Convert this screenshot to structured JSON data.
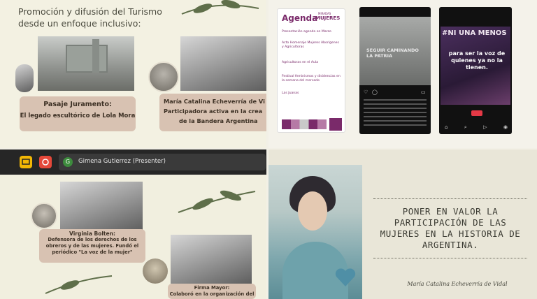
{
  "slide_tl": {
    "title": "Promoción y difusión del Turismo desde un enfoque inclusivo:",
    "cap1_line1": "Pasaje Juramento:",
    "cap1_line2": "El legado escultórico de Lola Mora",
    "cap2_line1": "María Catalina Echeverría de Vi",
    "cap2_line2": "Participadora activa en la crea",
    "cap2_line3": "de la Bandera Argentina"
  },
  "slide_tr": {
    "agenda_title": "Agenda",
    "agenda_brand_top": "MIRADAS",
    "agenda_brand": "MUJERES",
    "agenda_items": [
      "Presentación agenda en Marzo",
      "Acto Homenaje Mujeres Aborígenes y Agricultoras",
      "Agricultoras en el Aula",
      "Festival feminismos y disidencias en la semana del mercado",
      "Las Juanas"
    ],
    "post2_overlay": "SEGUIR CAMINANDO LA PATRIA",
    "post3_text_1": "#NI UNA MENOS",
    "post3_text_2": "para ser la voz de quienes ya no la tienen."
  },
  "presenter": {
    "name": "Gimena Gutierrez (Presenter)",
    "avatar_letter": "G"
  },
  "slide_bl": {
    "cap1_line1": "Virginia Bolten:",
    "cap1_line2": "Defensora de los derechos de los",
    "cap1_line3": "obreros y de las mujeres. Fundó el",
    "cap1_line4": "periódico \"La voz de la mujer\"",
    "cap2_line1": "Firma Mayor:",
    "cap2_line2": "Colaboró en la organización del"
  },
  "slide_br": {
    "headline": "PONER EN VALOR LA PARTICIPACIÓN DE LAS MUJERES EN LA HISTORIA DE ARGENTINA.",
    "signature": "María Catalina Echeverría de Vidal"
  },
  "colors": {
    "caption_bg": "#d8c2b2",
    "agenda_accent": "#7a2a6a",
    "presenter_bar": "#262626",
    "btn_yellow": "#f2b705",
    "btn_red": "#e5483a",
    "avatar_green": "#3d8b3d"
  }
}
